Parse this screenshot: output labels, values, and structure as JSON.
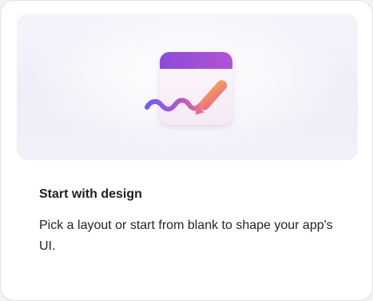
{
  "card": {
    "title": "Start with design",
    "description": "Pick a layout or start from blank to shape your app's UI.",
    "illustration_icon": "design-pen-icon"
  },
  "colors": {
    "window_header": "#9b4bd6",
    "window_body": "#fbf5fa",
    "stroke_start": "#7b4fe8",
    "stroke_end": "#f08a58",
    "pen_tip": "#f6a15a"
  }
}
